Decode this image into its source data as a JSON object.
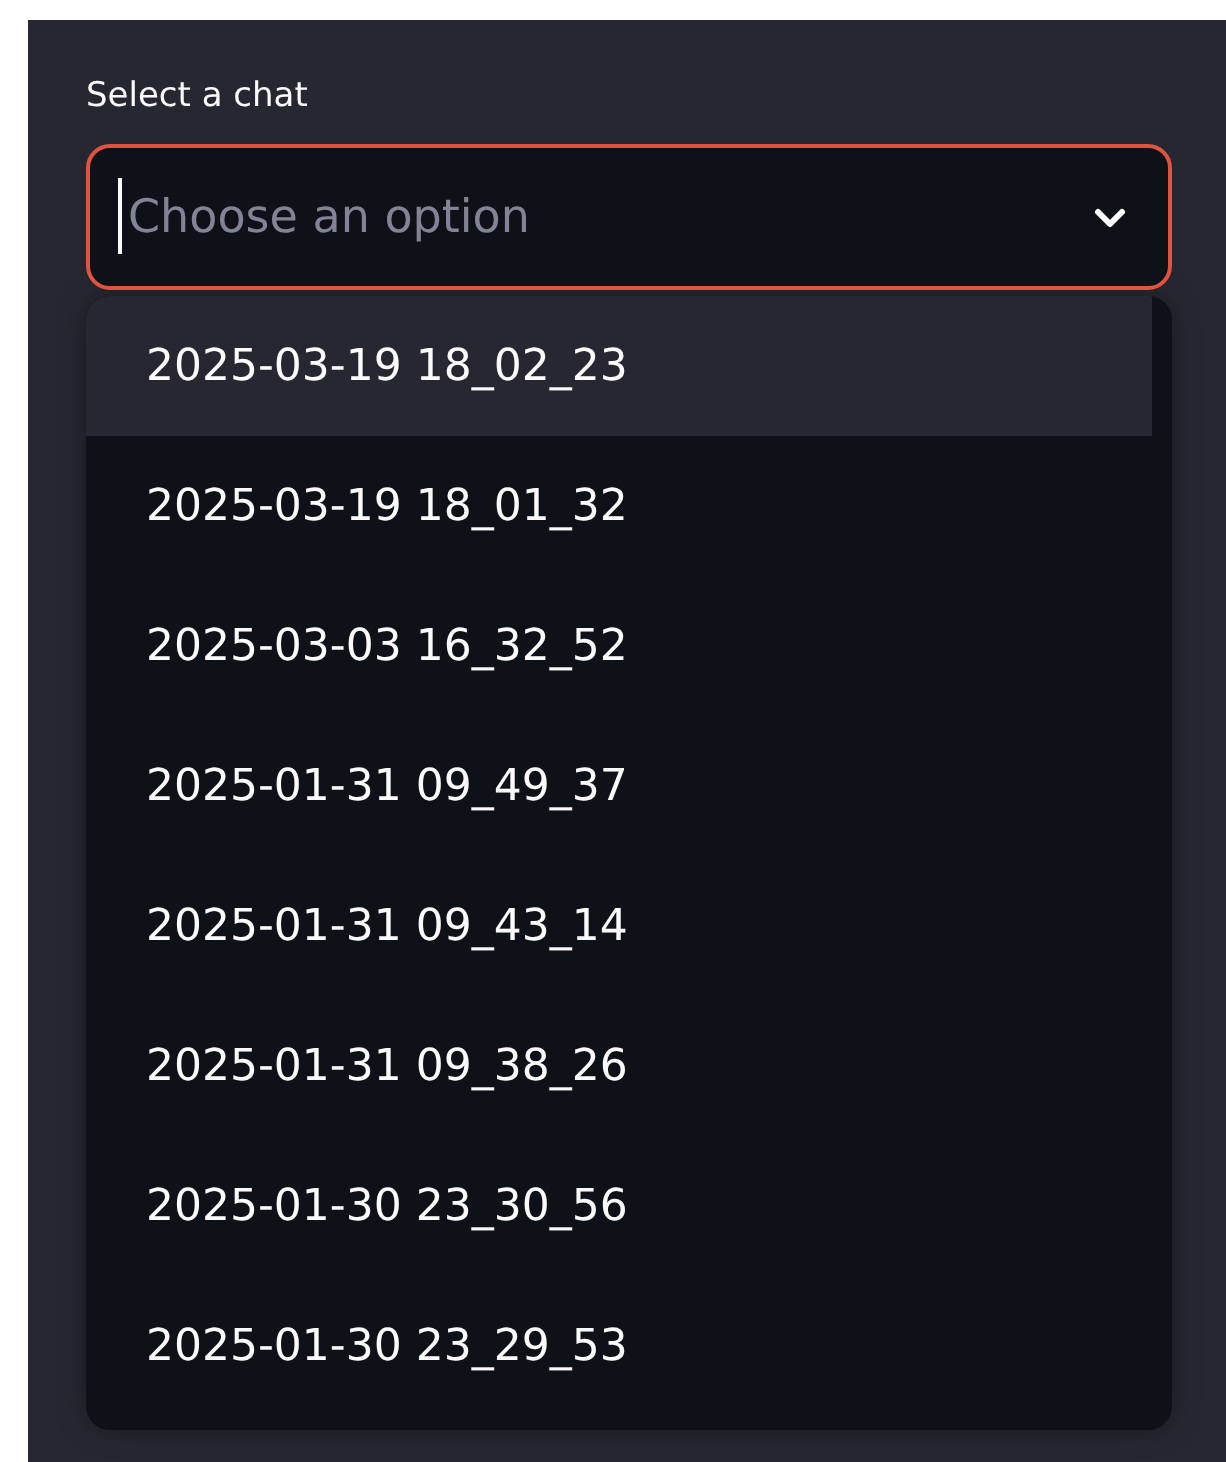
{
  "label": "Select a chat",
  "select": {
    "placeholder": "Choose an option",
    "focused": true
  },
  "options": [
    {
      "label": "2025-03-19 18_02_23",
      "selected": true
    },
    {
      "label": "2025-03-19 18_01_32",
      "selected": false
    },
    {
      "label": "2025-03-03 16_32_52",
      "selected": false
    },
    {
      "label": "2025-01-31 09_49_37",
      "selected": false
    },
    {
      "label": "2025-01-31 09_43_14",
      "selected": false
    },
    {
      "label": "2025-01-31 09_38_26",
      "selected": false
    },
    {
      "label": "2025-01-30 23_30_56",
      "selected": false
    },
    {
      "label": "2025-01-30 23_29_53",
      "selected": false
    }
  ]
}
